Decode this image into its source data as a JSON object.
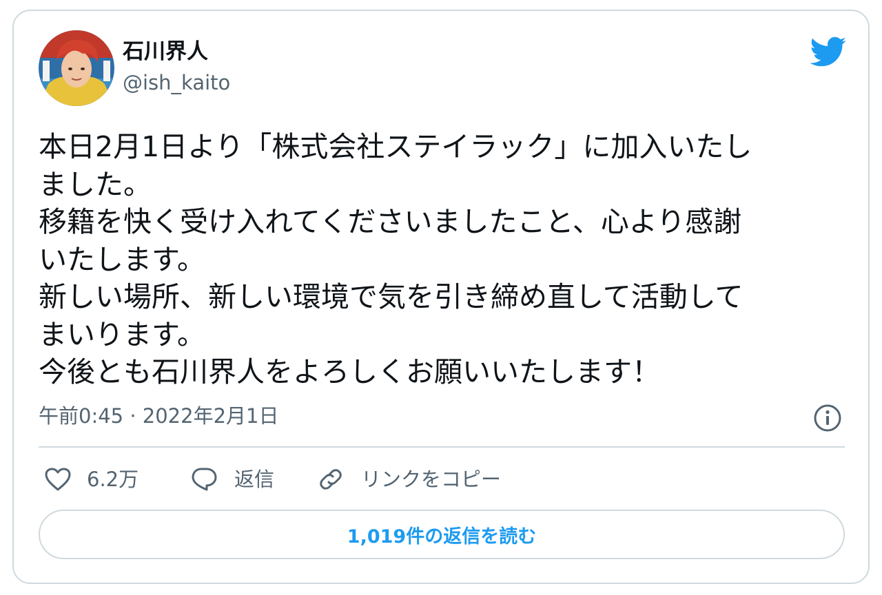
{
  "user": {
    "display_name": "石川界人",
    "handle": "@ish_kaito",
    "avatar_icon": "avatar-image"
  },
  "tweet": {
    "lines": [
      "本日2月1日より「株式会社ステイラック」に加入いたし",
      "ました。",
      "移籍を快く受け入れてくださいましたこと、心より感謝",
      "いたします。",
      "新しい場所、新しい環境で気を引き締め直して活動して",
      "まいります。",
      "今後とも石川界人をよろしくお願いいたします！"
    ],
    "timestamp": "午前0:45 · 2022年2月1日"
  },
  "actions": {
    "like_count": "6.2万",
    "reply_label": "返信",
    "copy_link_label": "リンクをコピー"
  },
  "read_replies_label": "1,019件の返信を読む",
  "colors": {
    "brand_blue": "#1d9bf0",
    "text_primary": "#0f1419",
    "text_secondary": "#536471",
    "border": "#cfd9de"
  },
  "icons": [
    "twitter-bird-icon",
    "info-icon",
    "heart-icon",
    "reply-bubble-icon",
    "link-icon"
  ]
}
